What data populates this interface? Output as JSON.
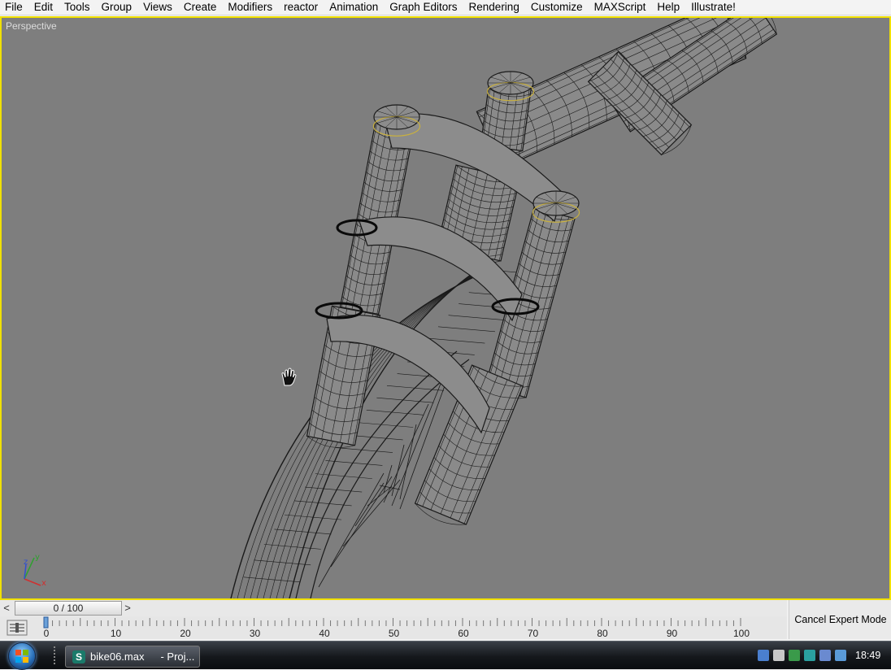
{
  "menubar": {
    "items": [
      "File",
      "Edit",
      "Tools",
      "Group",
      "Views",
      "Create",
      "Modifiers",
      "reactor",
      "Animation",
      "Graph Editors",
      "Rendering",
      "Customize",
      "MAXScript",
      "Help",
      "Illustrate!"
    ]
  },
  "viewport": {
    "label": "Perspective",
    "border_color": "#f0e000",
    "background_color": "#7e7e7e",
    "axis_labels": {
      "x": "x",
      "y": "y",
      "z": "z"
    }
  },
  "timeline": {
    "prev_label": "<",
    "next_label": ">",
    "slider_text": "0 / 100",
    "ticks": [
      "0",
      "10",
      "20",
      "30",
      "40",
      "50",
      "60",
      "70",
      "80",
      "90",
      "100"
    ],
    "cancel_expert_label": "Cancel Expert Mode"
  },
  "taskbar": {
    "task_title": "bike06.max",
    "task_suffix": "- Proj...",
    "clock": "18:49",
    "tray_icons": [
      "network-icon",
      "volume-icon",
      "network-status-icon",
      "security-icon",
      "display-icon",
      "messenger-icon"
    ]
  }
}
